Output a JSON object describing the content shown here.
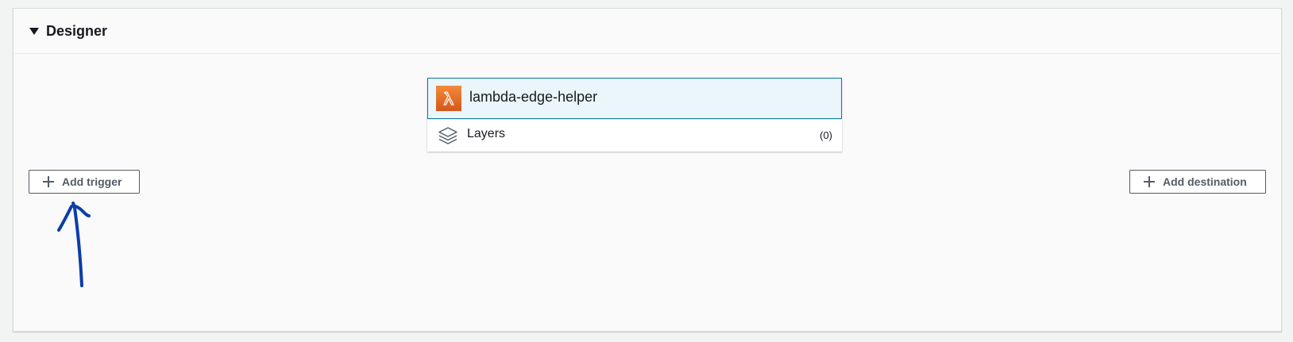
{
  "designer": {
    "title": "Designer",
    "function": {
      "name": "lambda-edge-helper",
      "icon": "lambda-icon"
    },
    "layers": {
      "label": "Layers",
      "count": "(0)",
      "icon": "layers-icon"
    },
    "add_trigger_label": "Add trigger",
    "add_destination_label": "Add destination"
  },
  "colors": {
    "lambda_orange": "#e7711e",
    "selected_bg": "#eaf6fb",
    "selected_border": "#0a7d99",
    "annotation_blue": "#0a3ea8",
    "button_text": "#545b64"
  }
}
